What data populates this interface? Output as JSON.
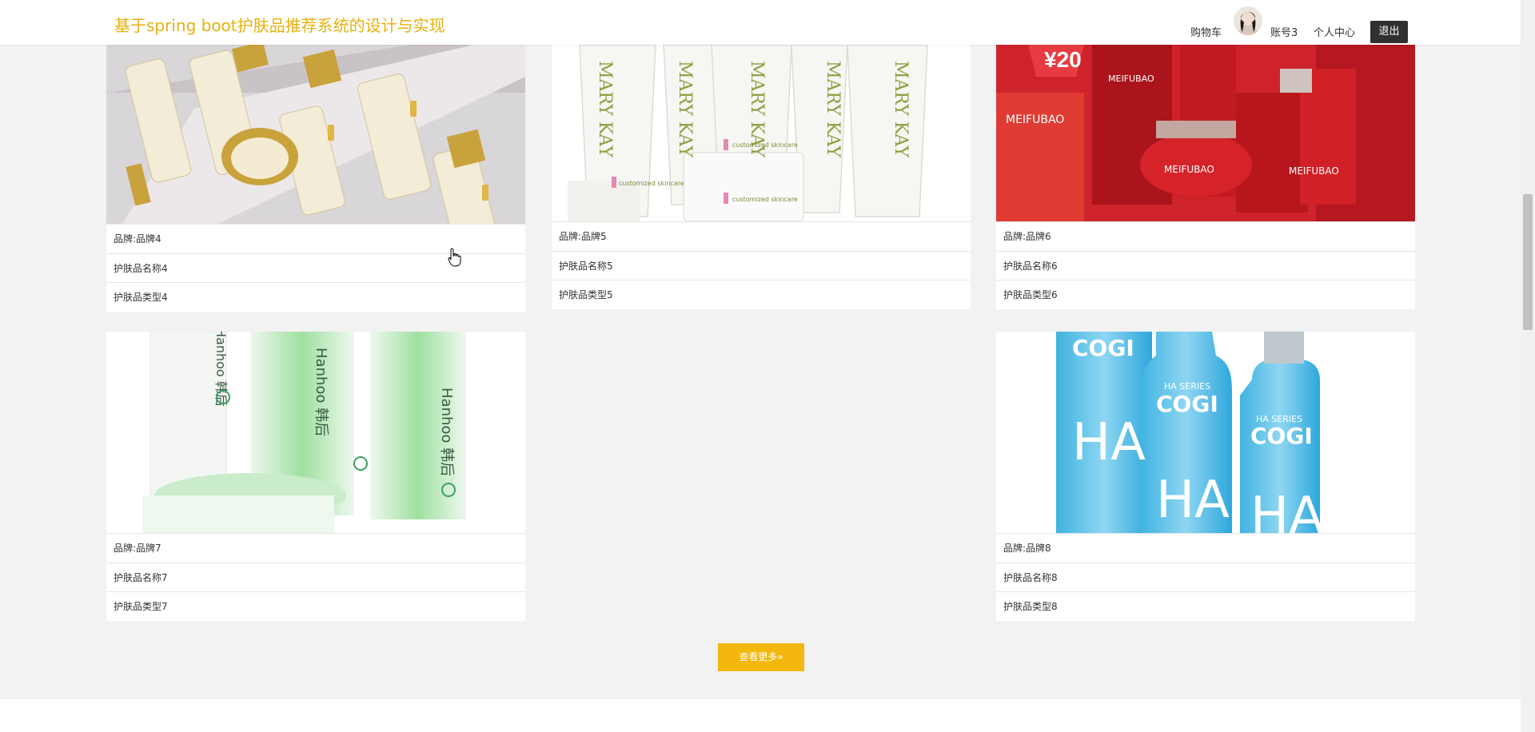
{
  "header": {
    "site_title": "基于spring boot护肤品推荐系统的设计与实现",
    "nav_cart": "购物车",
    "nav_account": "账号3",
    "nav_center": "个人中心",
    "logout": "退出"
  },
  "products": [
    {
      "brand": "品牌:品牌4",
      "name": "护肤品名称4",
      "type": "护肤品类型4"
    },
    {
      "brand": "品牌:品牌5",
      "name": "护肤品名称5",
      "type": "护肤品类型5"
    },
    {
      "brand": "品牌:品牌6",
      "name": "护肤品名称6",
      "type": "护肤品类型6"
    },
    {
      "brand": "品牌:品牌7",
      "name": "护肤品名称7",
      "type": "护肤品类型7"
    },
    {
      "brand": "品牌:品牌8",
      "name": "护肤品名称8",
      "type": "护肤品类型8"
    }
  ],
  "product_image_text": {
    "p5_brand": "MARY KAY",
    "p5_sub": "customized skincare",
    "p6_badge": "¥20",
    "p6_brand": "MEIFUBAO",
    "p7_brand": "Hanhoo 韩后",
    "p8_brand": "COGI",
    "p8_series": "HA SERIES",
    "p8_mark": "HA"
  },
  "load_more": "查看更多»",
  "colors": {
    "accent": "#f4b70d",
    "title": "#e8b10e",
    "logout_bg": "#2f3031",
    "page_bg": "#f2f2f2"
  }
}
